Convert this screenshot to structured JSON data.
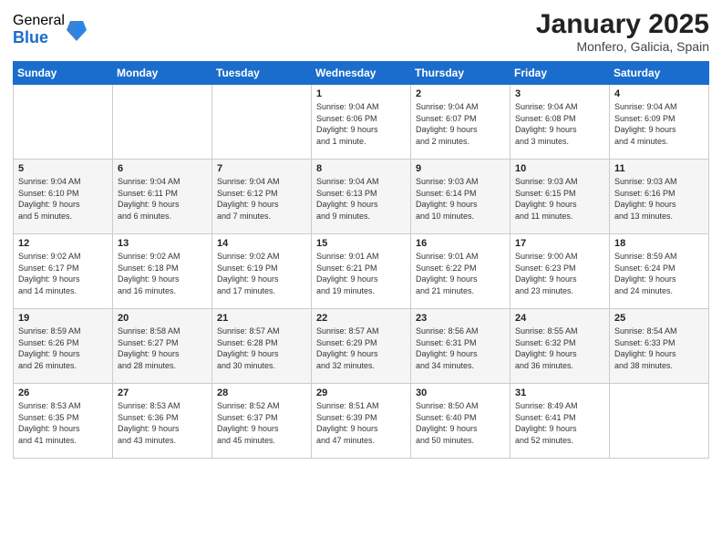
{
  "header": {
    "logo_general": "General",
    "logo_blue": "Blue",
    "month_title": "January 2025",
    "location": "Monfero, Galicia, Spain"
  },
  "days_of_week": [
    "Sunday",
    "Monday",
    "Tuesday",
    "Wednesday",
    "Thursday",
    "Friday",
    "Saturday"
  ],
  "weeks": [
    [
      {
        "day": "",
        "detail": ""
      },
      {
        "day": "",
        "detail": ""
      },
      {
        "day": "",
        "detail": ""
      },
      {
        "day": "1",
        "detail": "Sunrise: 9:04 AM\nSunset: 6:06 PM\nDaylight: 9 hours\nand 1 minute."
      },
      {
        "day": "2",
        "detail": "Sunrise: 9:04 AM\nSunset: 6:07 PM\nDaylight: 9 hours\nand 2 minutes."
      },
      {
        "day": "3",
        "detail": "Sunrise: 9:04 AM\nSunset: 6:08 PM\nDaylight: 9 hours\nand 3 minutes."
      },
      {
        "day": "4",
        "detail": "Sunrise: 9:04 AM\nSunset: 6:09 PM\nDaylight: 9 hours\nand 4 minutes."
      }
    ],
    [
      {
        "day": "5",
        "detail": "Sunrise: 9:04 AM\nSunset: 6:10 PM\nDaylight: 9 hours\nand 5 minutes."
      },
      {
        "day": "6",
        "detail": "Sunrise: 9:04 AM\nSunset: 6:11 PM\nDaylight: 9 hours\nand 6 minutes."
      },
      {
        "day": "7",
        "detail": "Sunrise: 9:04 AM\nSunset: 6:12 PM\nDaylight: 9 hours\nand 7 minutes."
      },
      {
        "day": "8",
        "detail": "Sunrise: 9:04 AM\nSunset: 6:13 PM\nDaylight: 9 hours\nand 9 minutes."
      },
      {
        "day": "9",
        "detail": "Sunrise: 9:03 AM\nSunset: 6:14 PM\nDaylight: 9 hours\nand 10 minutes."
      },
      {
        "day": "10",
        "detail": "Sunrise: 9:03 AM\nSunset: 6:15 PM\nDaylight: 9 hours\nand 11 minutes."
      },
      {
        "day": "11",
        "detail": "Sunrise: 9:03 AM\nSunset: 6:16 PM\nDaylight: 9 hours\nand 13 minutes."
      }
    ],
    [
      {
        "day": "12",
        "detail": "Sunrise: 9:02 AM\nSunset: 6:17 PM\nDaylight: 9 hours\nand 14 minutes."
      },
      {
        "day": "13",
        "detail": "Sunrise: 9:02 AM\nSunset: 6:18 PM\nDaylight: 9 hours\nand 16 minutes."
      },
      {
        "day": "14",
        "detail": "Sunrise: 9:02 AM\nSunset: 6:19 PM\nDaylight: 9 hours\nand 17 minutes."
      },
      {
        "day": "15",
        "detail": "Sunrise: 9:01 AM\nSunset: 6:21 PM\nDaylight: 9 hours\nand 19 minutes."
      },
      {
        "day": "16",
        "detail": "Sunrise: 9:01 AM\nSunset: 6:22 PM\nDaylight: 9 hours\nand 21 minutes."
      },
      {
        "day": "17",
        "detail": "Sunrise: 9:00 AM\nSunset: 6:23 PM\nDaylight: 9 hours\nand 23 minutes."
      },
      {
        "day": "18",
        "detail": "Sunrise: 8:59 AM\nSunset: 6:24 PM\nDaylight: 9 hours\nand 24 minutes."
      }
    ],
    [
      {
        "day": "19",
        "detail": "Sunrise: 8:59 AM\nSunset: 6:26 PM\nDaylight: 9 hours\nand 26 minutes."
      },
      {
        "day": "20",
        "detail": "Sunrise: 8:58 AM\nSunset: 6:27 PM\nDaylight: 9 hours\nand 28 minutes."
      },
      {
        "day": "21",
        "detail": "Sunrise: 8:57 AM\nSunset: 6:28 PM\nDaylight: 9 hours\nand 30 minutes."
      },
      {
        "day": "22",
        "detail": "Sunrise: 8:57 AM\nSunset: 6:29 PM\nDaylight: 9 hours\nand 32 minutes."
      },
      {
        "day": "23",
        "detail": "Sunrise: 8:56 AM\nSunset: 6:31 PM\nDaylight: 9 hours\nand 34 minutes."
      },
      {
        "day": "24",
        "detail": "Sunrise: 8:55 AM\nSunset: 6:32 PM\nDaylight: 9 hours\nand 36 minutes."
      },
      {
        "day": "25",
        "detail": "Sunrise: 8:54 AM\nSunset: 6:33 PM\nDaylight: 9 hours\nand 38 minutes."
      }
    ],
    [
      {
        "day": "26",
        "detail": "Sunrise: 8:53 AM\nSunset: 6:35 PM\nDaylight: 9 hours\nand 41 minutes."
      },
      {
        "day": "27",
        "detail": "Sunrise: 8:53 AM\nSunset: 6:36 PM\nDaylight: 9 hours\nand 43 minutes."
      },
      {
        "day": "28",
        "detail": "Sunrise: 8:52 AM\nSunset: 6:37 PM\nDaylight: 9 hours\nand 45 minutes."
      },
      {
        "day": "29",
        "detail": "Sunrise: 8:51 AM\nSunset: 6:39 PM\nDaylight: 9 hours\nand 47 minutes."
      },
      {
        "day": "30",
        "detail": "Sunrise: 8:50 AM\nSunset: 6:40 PM\nDaylight: 9 hours\nand 50 minutes."
      },
      {
        "day": "31",
        "detail": "Sunrise: 8:49 AM\nSunset: 6:41 PM\nDaylight: 9 hours\nand 52 minutes."
      },
      {
        "day": "",
        "detail": ""
      }
    ]
  ]
}
